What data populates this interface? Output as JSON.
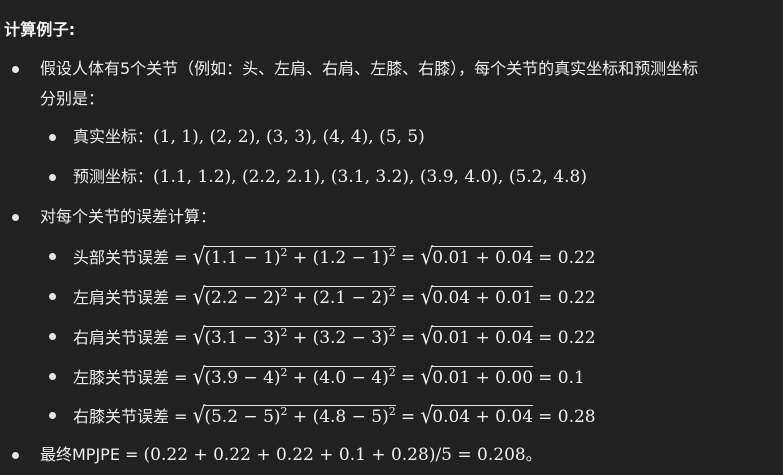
{
  "heading": "计算例子:",
  "intro": {
    "line1": "假设人体有5个关节（例如：头、左肩、右肩、左膝、右膝），每个关节的真实坐标和预测坐标",
    "line2": "分别是："
  },
  "true_coords": {
    "label": "真实坐标：",
    "values": "(1, 1), (2, 2), (3, 3), (4, 4), (5, 5)"
  },
  "pred_coords": {
    "label": "预测坐标：",
    "values": "(1.1, 1.2), (2.2, 2.1), (3.1, 3.2), (3.9, 4.0), (5.2, 4.8)"
  },
  "error_intro": "对每个关节的误差计算：",
  "errors": [
    {
      "label": "头部关节误差 =",
      "radicand_a": "(1.1 − 1)",
      "radicand_b": "(1.2 − 1)",
      "mid": "0.01 + 0.04",
      "result": "0.22"
    },
    {
      "label": "左肩关节误差 =",
      "radicand_a": "(2.2 − 2)",
      "radicand_b": "(2.1 − 2)",
      "mid": "0.04 + 0.01",
      "result": "0.22"
    },
    {
      "label": "右肩关节误差 =",
      "radicand_a": "(3.1 − 3)",
      "radicand_b": "(3.2 − 3)",
      "mid": "0.01 + 0.04",
      "result": "0.22"
    },
    {
      "label": "左膝关节误差 =",
      "radicand_a": "(3.9 − 4)",
      "radicand_b": "(4.0 − 4)",
      "mid": "0.01 + 0.00",
      "result": "0.1"
    },
    {
      "label": "右膝关节误差 =",
      "radicand_a": "(5.2 − 5)",
      "radicand_b": "(4.8 − 5)",
      "mid": "0.04 + 0.04",
      "result": "0.28"
    }
  ],
  "final": {
    "label": "最终MPJPE =",
    "expr": "(0.22 + 0.22 + 0.22 + 0.1 + 0.28)/5 = 0.208",
    "suffix": "。"
  }
}
